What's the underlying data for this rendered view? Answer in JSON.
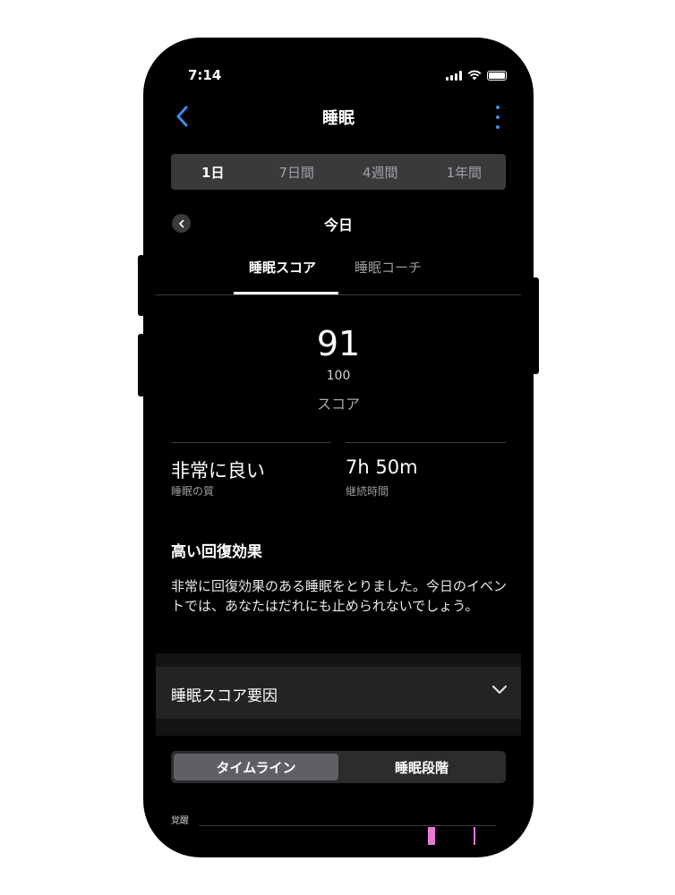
{
  "status_bar": {
    "time": "7:14"
  },
  "nav": {
    "title": "睡眠"
  },
  "period_tabs": [
    "1日",
    "7日間",
    "4週間",
    "1年間"
  ],
  "date_label": "今日",
  "content_tabs": [
    "睡眠スコア",
    "睡眠コーチ"
  ],
  "score": {
    "value": "91",
    "max": "100",
    "label": "スコア"
  },
  "stats": [
    {
      "value": "非常に良い",
      "label": "睡眠の質"
    },
    {
      "value": "7h 50m",
      "label": "継続時間"
    }
  ],
  "insight": {
    "heading": "高い回復効果",
    "body": "非常に回復効果のある睡眠をとりました。今日のイベントでは、あなたはだれにも止められないでしょう。"
  },
  "factors": {
    "label": "睡眠スコア要因"
  },
  "view_toggle": [
    "タイムライン",
    "睡眠段階"
  ],
  "timeline": {
    "awake_label": "覚醒"
  },
  "colors": {
    "accent": "#3b8fe8",
    "awake": "#e47ad6",
    "background": "#000000"
  }
}
